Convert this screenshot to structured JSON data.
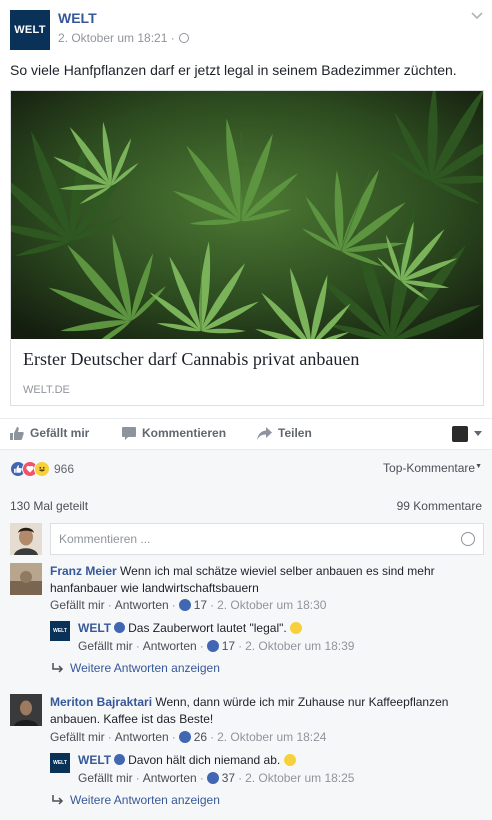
{
  "post": {
    "page_name": "WELT",
    "logo_text": "WELT",
    "timestamp": "2. Oktober um 18:21 ·",
    "text": "So viele Hanfpflanzen darf er jetzt legal in seinem Badezimmer züchten.",
    "link": {
      "title": "Erster Deutscher darf Cannabis privat anbauen",
      "domain": "WELT.DE"
    }
  },
  "actions": {
    "like": "Gefällt mir",
    "comment": "Kommentieren",
    "share": "Teilen"
  },
  "stats": {
    "reaction_count": "966",
    "sort": "Top-Kommentare",
    "shares": "130 Mal geteilt",
    "comments": "99 Kommentare"
  },
  "composer": {
    "placeholder": "Kommentieren ..."
  },
  "comments": [
    {
      "author": "Franz Meier",
      "text": "Wenn ich mal schätze wieviel selber anbauen es sind mehr hanfanbauer wie landwirtschaftsbauern",
      "like_label": "Gefällt mir",
      "reply_label": "Antworten",
      "likes": "17",
      "time": "2. Oktober um 18:30",
      "reply": {
        "author": "WELT",
        "avatar_text": "WELT",
        "text": "Das Zauberwort lautet \"legal\".",
        "like_label": "Gefällt mir",
        "reply_label": "Antworten",
        "likes": "17",
        "time": "2. Oktober um 18:39"
      },
      "more_replies": "Weitere Antworten anzeigen"
    },
    {
      "author": "Meriton Bajraktari",
      "text": "Wenn, dann würde ich mir Zuhause nur Kaffeepflanzen anbauen. Kaffee ist das Beste!",
      "like_label": "Gefällt mir",
      "reply_label": "Antworten",
      "likes": "26",
      "time": "2. Oktober um 18:24",
      "reply": {
        "author": "WELT",
        "avatar_text": "WELT",
        "text": "Davon hält dich niemand ab.",
        "like_label": "Gefällt mir",
        "reply_label": "Antworten",
        "likes": "37",
        "time": "2. Oktober um 18:25"
      },
      "more_replies": "Weitere Antworten anzeigen"
    }
  ],
  "colors": {
    "link": "#365899",
    "brand": "#0a3259",
    "like": "#4267b2",
    "love": "#f25268",
    "haha": "#f7d13c"
  }
}
